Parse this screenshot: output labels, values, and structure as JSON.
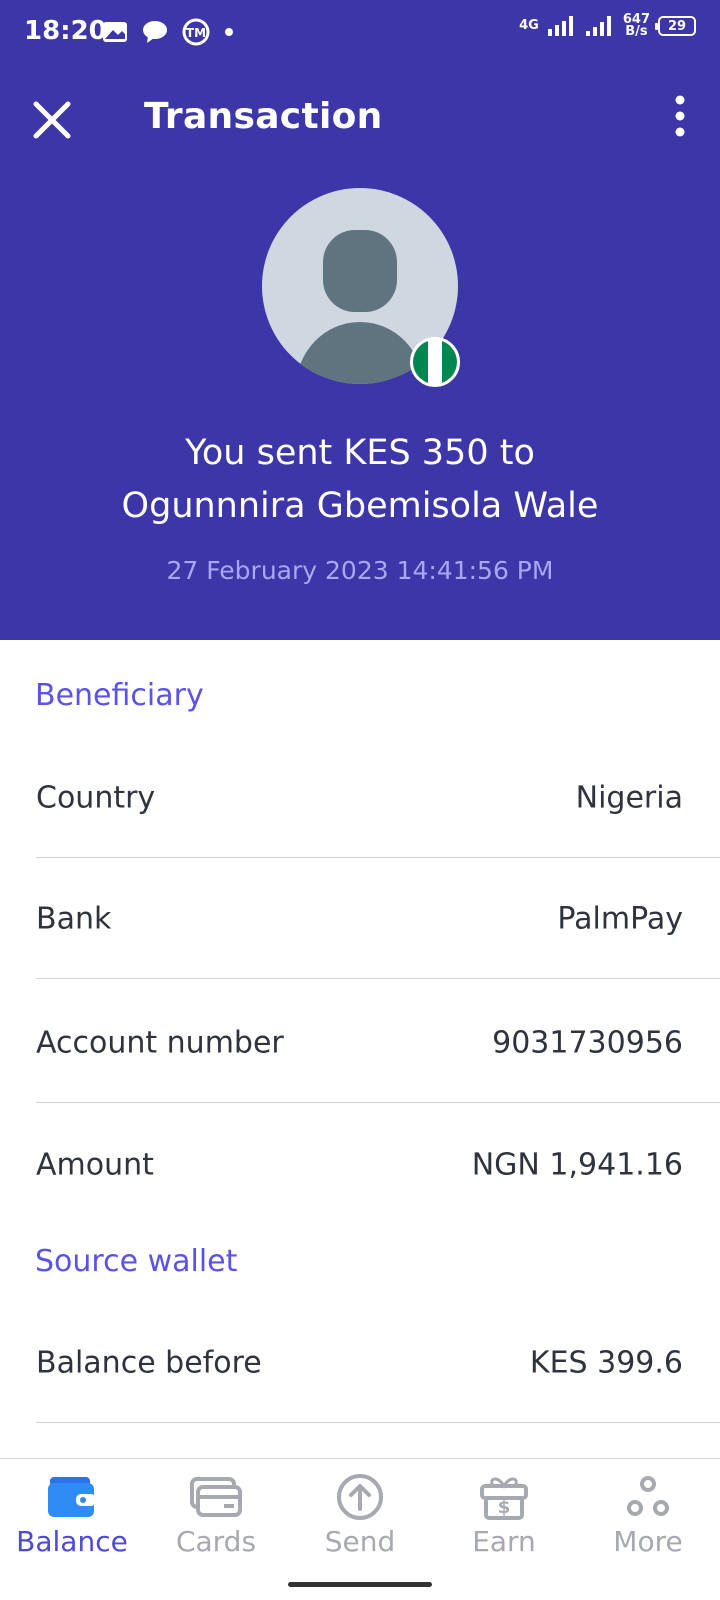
{
  "status_bar": {
    "time": "18:20",
    "network_type": "4G",
    "speed_value": "647",
    "speed_unit": "B/s",
    "battery": "29"
  },
  "app_bar": {
    "title": "Transaction"
  },
  "summary": {
    "sent_line1": "You sent KES 350 to",
    "sent_line2": "Ogunnnira Gbemisola Wale",
    "date": "27 February 2023 14:41:56 PM",
    "flag_colors": [
      "#008751",
      "#ffffff",
      "#008751"
    ]
  },
  "beneficiary": {
    "section_title": "Beneficiary",
    "rows": [
      {
        "label": "Country",
        "value": "Nigeria"
      },
      {
        "label": "Bank",
        "value": "PalmPay"
      },
      {
        "label": "Account number",
        "value": "9031730956"
      },
      {
        "label": "Amount",
        "value": "NGN 1,941.16"
      }
    ]
  },
  "source_wallet": {
    "section_title": "Source wallet",
    "rows": [
      {
        "label": "Balance before",
        "value": "KES 399.6"
      }
    ]
  },
  "bottom_nav": {
    "items": [
      {
        "label": "Balance",
        "icon": "wallet-icon",
        "active": true
      },
      {
        "label": "Cards",
        "icon": "cards-icon",
        "active": false
      },
      {
        "label": "Send",
        "icon": "send-icon",
        "active": false
      },
      {
        "label": "Earn",
        "icon": "gift-icon",
        "active": false
      },
      {
        "label": "More",
        "icon": "more-dots-icon",
        "active": false
      }
    ]
  },
  "colors": {
    "header_bg": "#3c36a8",
    "accent": "#5b52e6",
    "active_nav": "#4f48d8",
    "inactive_nav": "#a7a9b0"
  }
}
